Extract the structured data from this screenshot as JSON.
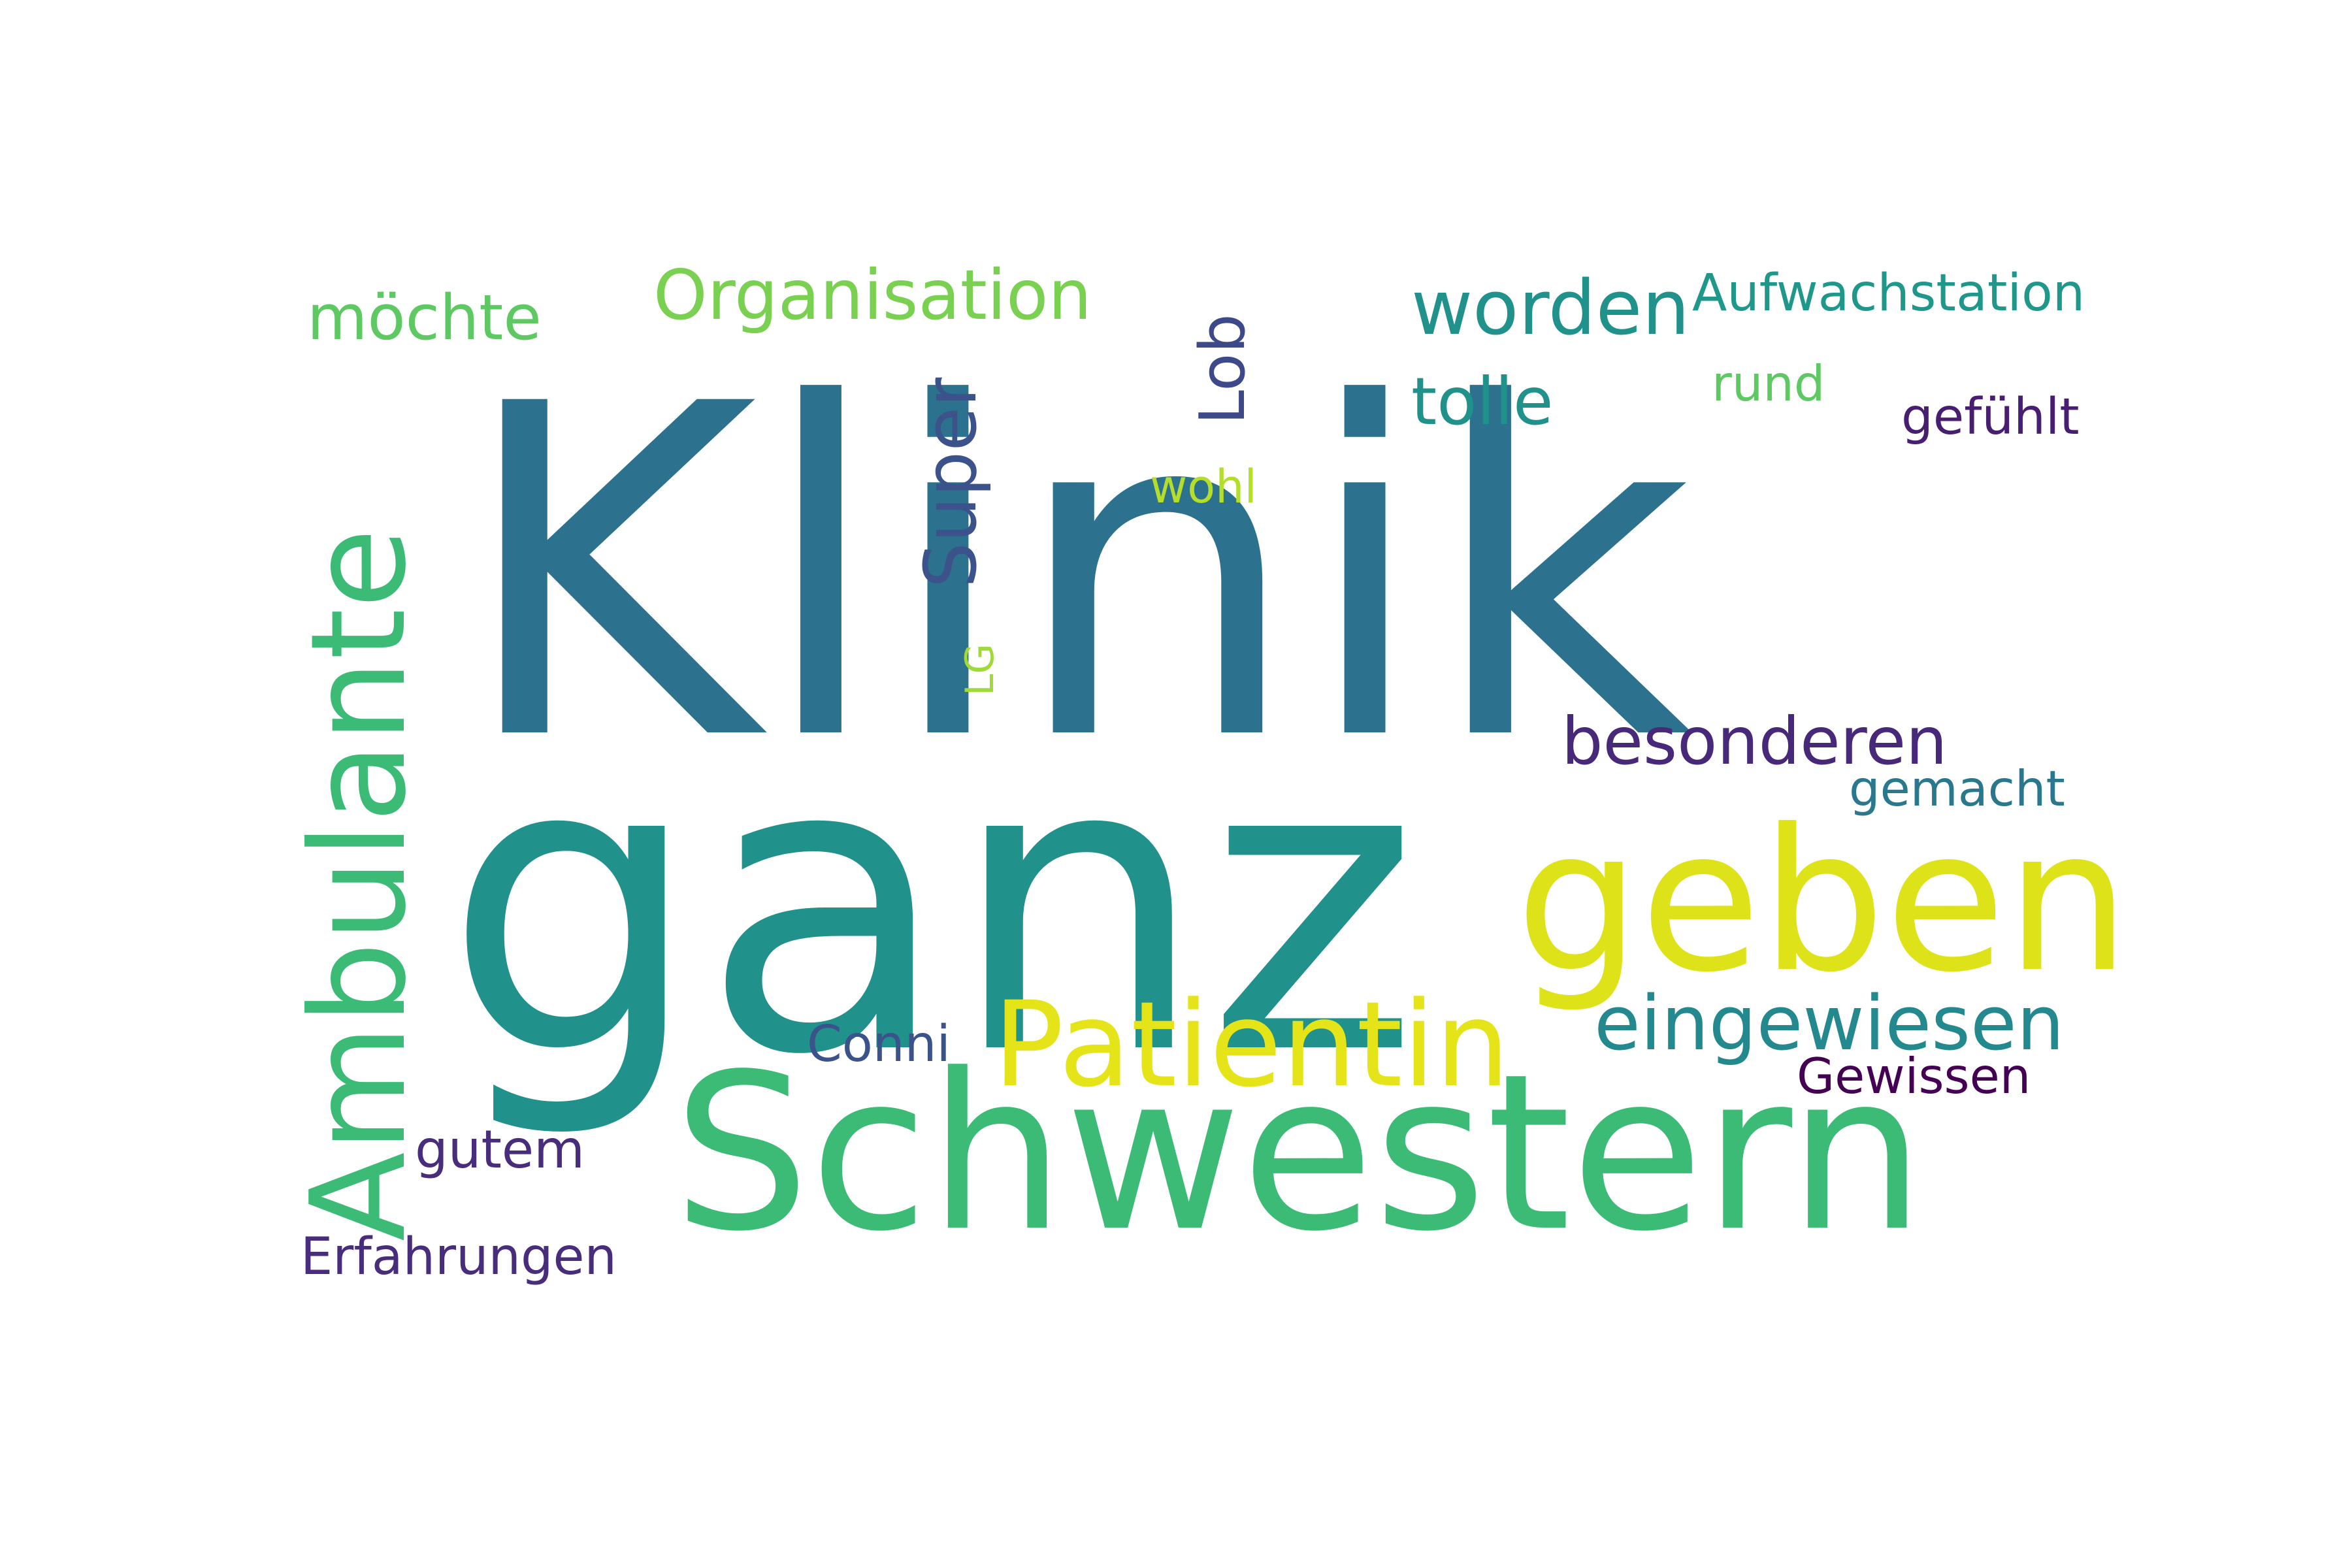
{
  "words": [
    {
      "text": "Klinik",
      "color": "#2c728e"
    },
    {
      "text": "ganz",
      "color": "#21918c"
    },
    {
      "text": "Schwestern",
      "color": "#3bbb75"
    },
    {
      "text": "geben",
      "color": "#dde318"
    },
    {
      "text": "Ambulante",
      "color": "#3bbb75"
    },
    {
      "text": "Patientin",
      "color": "#e5e419"
    },
    {
      "text": "eingewiesen",
      "color": "#23898e"
    },
    {
      "text": "besonderen",
      "color": "#482878"
    },
    {
      "text": "worden",
      "color": "#21918c"
    },
    {
      "text": "Organisation",
      "color": "#7ad151"
    },
    {
      "text": "möchte",
      "color": "#5ec962"
    },
    {
      "text": "tolle",
      "color": "#21918c"
    },
    {
      "text": "Aufwachstation",
      "color": "#1f988b"
    },
    {
      "text": "Super",
      "color": "#3b528b"
    },
    {
      "text": "Lob",
      "color": "#3e4989"
    },
    {
      "text": "rund",
      "color": "#5ec962"
    },
    {
      "text": "gefühlt",
      "color": "#481f70"
    },
    {
      "text": "wohl",
      "color": "#b5de2b"
    },
    {
      "text": "LG",
      "color": "#a0da39"
    },
    {
      "text": "gemacht",
      "color": "#2a788e"
    },
    {
      "text": "Conni",
      "color": "#3b528b"
    },
    {
      "text": "Gewissen",
      "color": "#440154"
    },
    {
      "text": "gutem",
      "color": "#472d7b"
    },
    {
      "text": "Erfahrungen",
      "color": "#472d7b"
    }
  ]
}
